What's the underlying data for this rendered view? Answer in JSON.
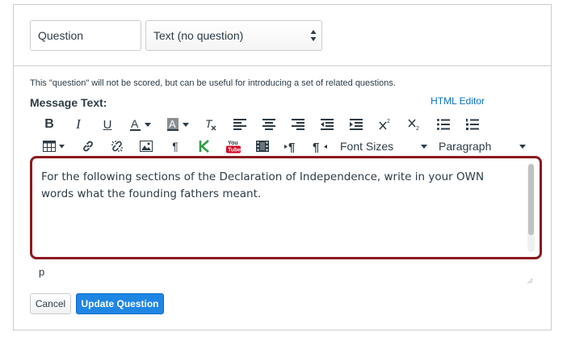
{
  "question": {
    "name_value": "Question",
    "type_value": "Text (no question)"
  },
  "note": "This \"question\" will not be scored, but can be useful for introducing a set of related questions.",
  "message_label": "Message Text:",
  "html_editor_link": "HTML Editor",
  "toolbar": {
    "row1_icons": [
      "bold-icon",
      "italic-icon",
      "underline-icon",
      "text-color-icon",
      "background-color-icon",
      "clear-formatting-icon",
      "align-left-icon",
      "align-center-icon",
      "align-right-icon",
      "outdent-icon",
      "indent-icon",
      "superscript-icon",
      "subscript-icon",
      "bullet-list-icon",
      "numbered-list-icon"
    ],
    "row2_icons": [
      "table-icon",
      "link-icon",
      "unlink-icon",
      "image-icon",
      "pilcrow-icon",
      "kaltura-icon",
      "youtube-icon",
      "media-icon",
      "ltr-icon",
      "rtl-icon"
    ],
    "font_sizes_label": "Font Sizes",
    "paragraph_label": "Paragraph",
    "youtube_text": "You Tube"
  },
  "editor": {
    "content": "For the following sections of the Declaration of Independence, write in your OWN words what the founding fathers meant.",
    "border_color": "#8b1a1f"
  },
  "status_path": "p",
  "buttons": {
    "cancel": "Cancel",
    "update": "Update Question"
  },
  "colors": {
    "primary": "#1f86e4",
    "link": "#0770c3",
    "text": "#2d3b45"
  }
}
